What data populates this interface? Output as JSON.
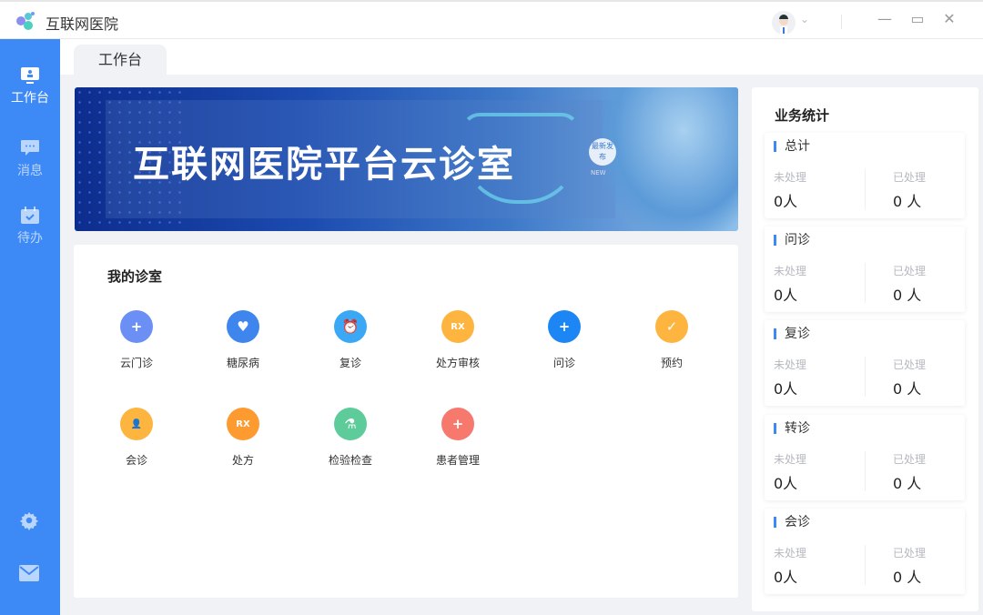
{
  "app": {
    "title": "互联网医院"
  },
  "sidebar": {
    "items": [
      {
        "label": "工作台"
      },
      {
        "label": "消息"
      },
      {
        "label": "待办"
      }
    ]
  },
  "tabs": [
    {
      "label": "工作台"
    }
  ],
  "banner": {
    "title": "互联网医院平台云诊室",
    "badge": "最新发布",
    "badge_sub": "NEW"
  },
  "clinic": {
    "title": "我的诊室",
    "items": [
      {
        "label": "云门诊",
        "color": "#6b8ff5",
        "glyph": "+"
      },
      {
        "label": "糖尿病",
        "color": "#3e86ee",
        "glyph": "♥"
      },
      {
        "label": "复诊",
        "color": "#3aa8f5",
        "glyph": "⏰"
      },
      {
        "label": "处方审核",
        "color": "#fdb540",
        "glyph": "RX"
      },
      {
        "label": "问诊",
        "color": "#1d86f5",
        "glyph": "+"
      },
      {
        "label": "预约",
        "color": "#fdb540",
        "glyph": "✓"
      },
      {
        "label": "会诊",
        "color": "#fdb540",
        "glyph": "👤"
      },
      {
        "label": "处方",
        "color": "#fd9a30",
        "glyph": "RX"
      },
      {
        "label": "检验检查",
        "color": "#5ecb9a",
        "glyph": "⚗"
      },
      {
        "label": "患者管理",
        "color": "#f7786c",
        "glyph": "+"
      }
    ]
  },
  "stats": {
    "title": "业务统计",
    "pending_label": "未处理",
    "done_label": "已处理",
    "groups": [
      {
        "name": "总计",
        "pending": "0人",
        "done": "0 人"
      },
      {
        "name": "问诊",
        "pending": "0人",
        "done": "0 人"
      },
      {
        "name": "复诊",
        "pending": "0人",
        "done": "0 人"
      },
      {
        "name": "转诊",
        "pending": "0人",
        "done": "0 人"
      },
      {
        "name": "会诊",
        "pending": "0人",
        "done": "0 人"
      }
    ]
  }
}
